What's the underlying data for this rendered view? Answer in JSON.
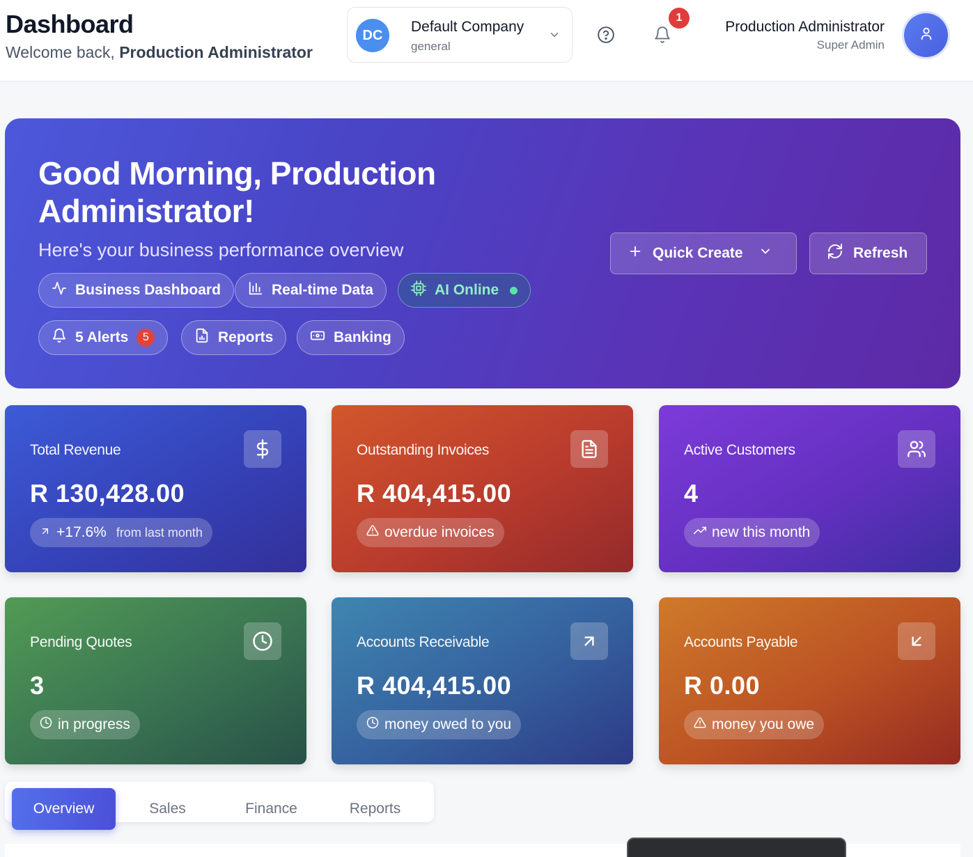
{
  "header": {
    "title": "Dashboard",
    "welcome_prefix": "Welcome back,",
    "welcome_name": "Production Administrator",
    "company": {
      "initials": "DC",
      "name": "Default Company",
      "sub": "general"
    },
    "notifications_count": "1",
    "user": {
      "name": "Production Administrator",
      "role": "Super Admin"
    }
  },
  "hero": {
    "title": "Good Morning, Production Administrator!",
    "subtitle": "Here's your business performance overview",
    "chips": {
      "business_dashboard": "Business Dashboard",
      "realtime": "Real-time Data",
      "ai": "AI Online",
      "alerts": "5 Alerts",
      "alerts_count": "5",
      "reports": "Reports",
      "banking": "Banking"
    },
    "quick_create": "Quick Create",
    "refresh": "Refresh"
  },
  "stats": {
    "revenue": {
      "label": "Total Revenue",
      "value": "R 130,428.00",
      "change": "+17.6%",
      "change_note": "from last month"
    },
    "invoices": {
      "label": "Outstanding Invoices",
      "value": "R 404,415.00",
      "note": "overdue invoices"
    },
    "customers": {
      "label": "Active Customers",
      "value": "4",
      "note": "new this month"
    },
    "quotes": {
      "label": "Pending Quotes",
      "value": "3",
      "note": "in progress"
    },
    "receivable": {
      "label": "Accounts Receivable",
      "value": "R 404,415.00",
      "note": "money owed to you"
    },
    "payable": {
      "label": "Accounts Payable",
      "value": "R 0.00",
      "note": "money you owe"
    }
  },
  "tabs": [
    "Overview",
    "Sales",
    "Finance",
    "Reports"
  ],
  "icons": {
    "help": "help-circle-icon",
    "bell": "bell-icon",
    "user": "user-icon",
    "chevron": "chevron-down-icon",
    "activity": "activity-icon",
    "bar_chart": "bar-chart-icon",
    "cpu": "cpu-icon",
    "file_chart": "file-chart-icon",
    "banknote": "banknote-icon",
    "plus": "plus-icon",
    "refresh": "refresh-icon",
    "dollar": "dollar-icon",
    "file_text": "file-text-icon",
    "users": "users-icon",
    "clock": "clock-icon",
    "arrow_up_right": "arrow-up-right-icon",
    "arrow_down_left": "arrow-down-left-icon",
    "alert": "alert-triangle-icon",
    "trending": "trending-up-icon"
  },
  "colors": {
    "accent": "#4b4fd8",
    "hero_start": "#4c58da",
    "hero_end": "#5d2aa6",
    "badge_red": "#e13b3b",
    "ai_green": "#8ff0c6"
  }
}
